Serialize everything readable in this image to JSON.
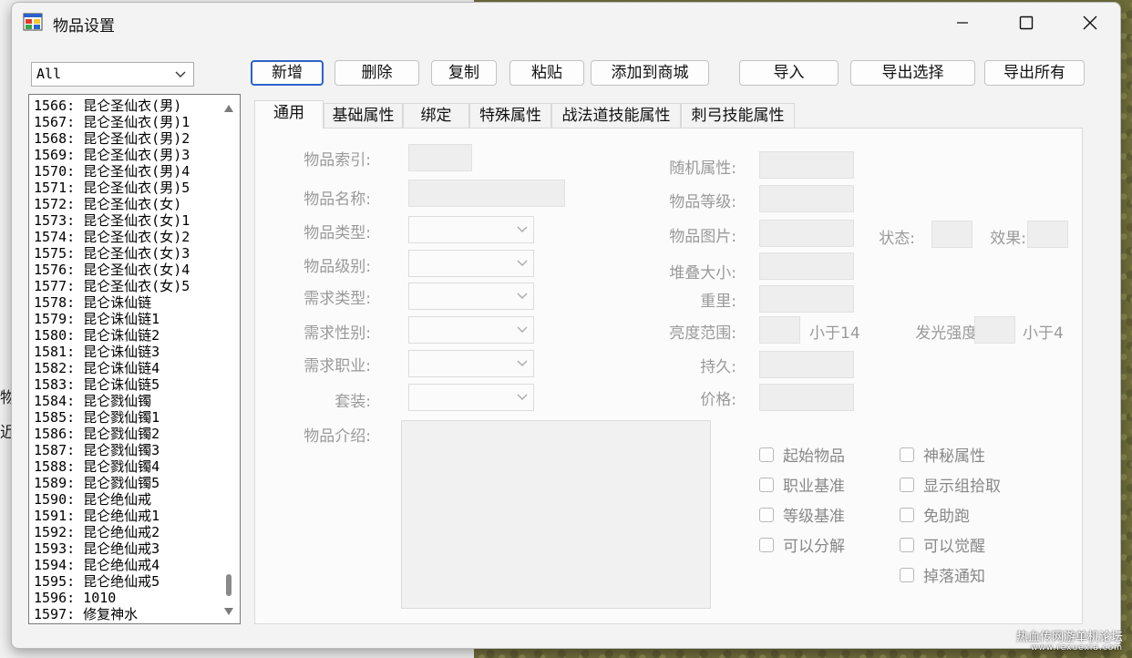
{
  "window": {
    "title": "物品设置"
  },
  "background_fragments": [
    "物",
    "近"
  ],
  "filter": {
    "value": "All"
  },
  "list": {
    "items": [
      "1566: 昆仑圣仙衣(男)",
      "1567: 昆仑圣仙衣(男)1",
      "1568: 昆仑圣仙衣(男)2",
      "1569: 昆仑圣仙衣(男)3",
      "1570: 昆仑圣仙衣(男)4",
      "1571: 昆仑圣仙衣(男)5",
      "1572: 昆仑圣仙衣(女)",
      "1573: 昆仑圣仙衣(女)1",
      "1574: 昆仑圣仙衣(女)2",
      "1575: 昆仑圣仙衣(女)3",
      "1576: 昆仑圣仙衣(女)4",
      "1577: 昆仑圣仙衣(女)5",
      "1578: 昆仑诛仙链",
      "1579: 昆仑诛仙链1",
      "1580: 昆仑诛仙链2",
      "1581: 昆仑诛仙链3",
      "1582: 昆仑诛仙链4",
      "1583: 昆仑诛仙链5",
      "1584: 昆仑戮仙镯",
      "1585: 昆仑戮仙镯1",
      "1586: 昆仑戮仙镯2",
      "1587: 昆仑戮仙镯3",
      "1588: 昆仑戮仙镯4",
      "1589: 昆仑戮仙镯5",
      "1590: 昆仑绝仙戒",
      "1591: 昆仑绝仙戒1",
      "1592: 昆仑绝仙戒2",
      "1593: 昆仑绝仙戒3",
      "1594: 昆仑绝仙戒4",
      "1595: 昆仑绝仙戒5",
      "1596: 1010",
      "1597: 修复神水"
    ]
  },
  "toolbar": {
    "new": "新增",
    "delete": "删除",
    "copy": "复制",
    "paste": "粘贴",
    "add_to_shop": "添加到商城",
    "import": "导入",
    "export_selected": "导出选择",
    "export_all": "导出所有"
  },
  "tabs": [
    "通用",
    "基础属性",
    "绑定",
    "特殊属性",
    "战法道技能属性",
    "刺弓技能属性"
  ],
  "form": {
    "item_index": "物品索引:",
    "item_name": "物品名称:",
    "item_type": "物品类型:",
    "item_grade": "物品级别:",
    "req_type": "需求类型:",
    "req_gender": "需求性别:",
    "req_class": "需求职业:",
    "set": "套装:",
    "item_desc": "物品介绍:",
    "random_attr": "随机属性:",
    "item_level": "物品等级:",
    "item_image": "物品图片:",
    "state": "状态:",
    "effect": "效果:",
    "stack_size": "堆叠大小:",
    "weight": "重里:",
    "light_range": "亮度范围:",
    "light_range_hint": "小于14",
    "glow_intensity": "发光强度:",
    "glow_hint": "小于4",
    "durability": "持久:",
    "price": "价格:"
  },
  "checkboxes": {
    "start_item": "起始物品",
    "class_base": "职业基准",
    "level_base": "等级基准",
    "decomposable": "可以分解",
    "mystery_attr": "神秘属性",
    "show_group_pickup": "显示组拾取",
    "no_assist_run": "免助跑",
    "awakenable": "可以觉醒",
    "drop_notify": "掉落通知"
  },
  "watermark": {
    "line1": "热血传网游单机论坛",
    "line2": "www.rexuexia.com"
  },
  "colors": {
    "accent": "#2a63c9",
    "disabled_text": "#9a9a9a"
  }
}
